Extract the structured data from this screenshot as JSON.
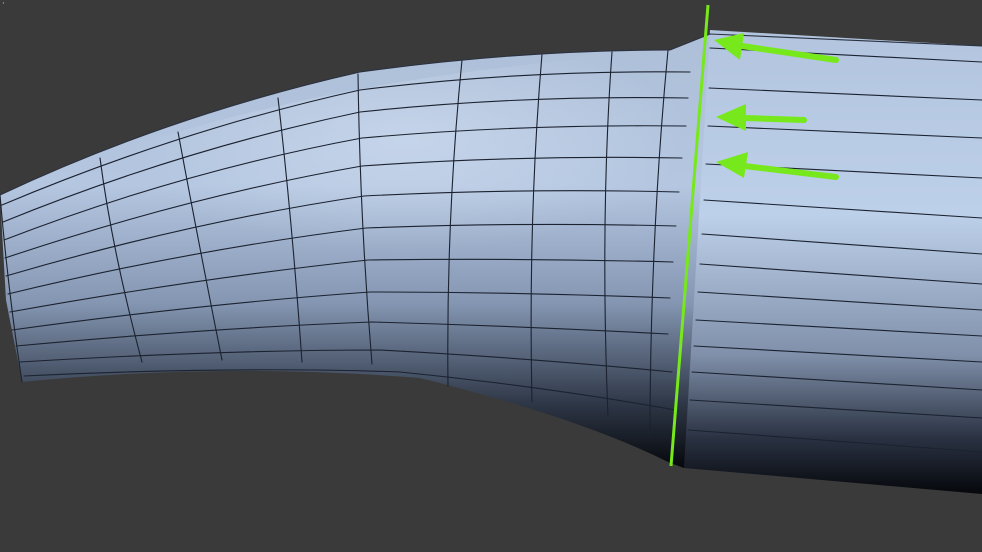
{
  "viewport": {
    "background": "#3a3a3a",
    "corner_label": "·"
  },
  "model": {
    "surface_light": "#bccfe8",
    "surface_mid": "#8ea0bc",
    "surface_dark": "#0c0f16",
    "wire_color": "#1b2230"
  },
  "annotations": {
    "accent": "#77e81c",
    "icons": [
      "arrow-left-icon",
      "arrow-left-icon",
      "arrow-left-icon"
    ]
  }
}
